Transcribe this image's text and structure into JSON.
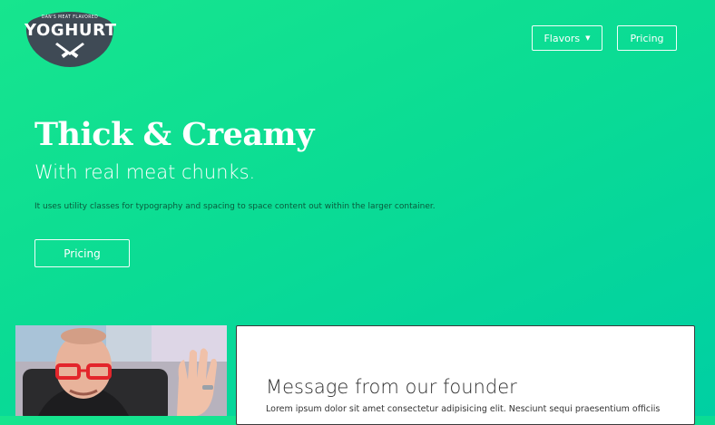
{
  "logo": {
    "tagline": "DAN'S MEAT FLAVORED",
    "name": "YOGHURT",
    "icon": "crossed-knives-icon"
  },
  "nav": {
    "flavors_label": "Flavors",
    "flavors_icon": "caret-down-icon",
    "pricing_label": "Pricing"
  },
  "hero": {
    "title": "Thick & Creamy",
    "subtitle": "With real meat chunks.",
    "description": "It uses utility classes for typography and spacing to space content out within the larger container.",
    "button_label": "Pricing"
  },
  "founder": {
    "photo_alt": "founder-photo",
    "title": "Message from our founder",
    "text": "Lorem ipsum dolor sit amet consectetur adipisicing elit. Nesciunt sequi praesentium officiis"
  },
  "colors": {
    "gradient_start": "#17e58e",
    "gradient_end": "#00cfa3",
    "logo_badge": "#3f4a55",
    "card_bg": "#ffffff"
  }
}
